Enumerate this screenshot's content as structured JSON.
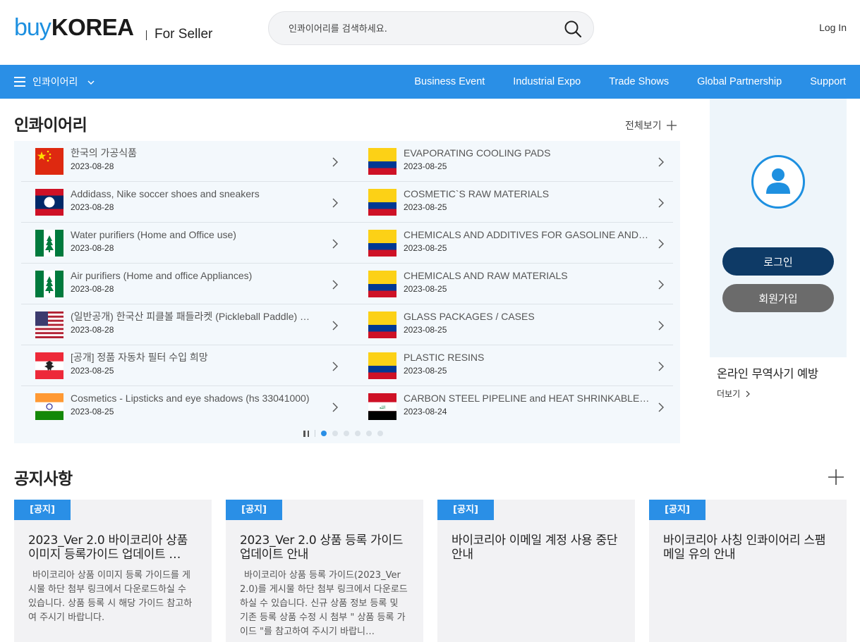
{
  "header": {
    "logo_buy": "buy",
    "logo_korea": "KOREA",
    "logo_sub": "For Seller",
    "search_placeholder": "인콰이어리를 검색하세요.",
    "login": "Log In"
  },
  "nav": {
    "menu_label": "인콰이어리",
    "links": [
      "Business Event",
      "Industrial Expo",
      "Trade Shows",
      "Global Partnership",
      "Support"
    ]
  },
  "inquiries": {
    "title": "인콰이어리",
    "view_all": "전체보기",
    "left": [
      {
        "name": "한국의 가공식품",
        "date": "2023-08-28",
        "flag": "china-flag"
      },
      {
        "name": "Addidass, Nike soccer shoes and sneakers",
        "date": "2023-08-28",
        "flag": "laos-flag"
      },
      {
        "name": "Water purifiers (Home and Office use)",
        "date": "2023-08-28",
        "flag": "norfolk-island-flag"
      },
      {
        "name": "Air purifiers (Home and office Appliances)",
        "date": "2023-08-28",
        "flag": "norfolk-island-flag"
      },
      {
        "name": "(일반공개) 한국산 피클볼 패들라켓 (Pickleball Paddle) 제…",
        "date": "2023-08-28",
        "flag": "usa-flag"
      },
      {
        "name": "[공개] 정품 자동차 필터 수입 희망",
        "date": "2023-08-25",
        "flag": "austria-flag"
      },
      {
        "name": "Cosmetics - Lipsticks and eye shadows (hs 33041000)",
        "date": "2023-08-25",
        "flag": "india-flag"
      }
    ],
    "right": [
      {
        "name": "EVAPORATING COOLING PADS",
        "date": "2023-08-25",
        "flag": "colombia-flag"
      },
      {
        "name": "COSMETIC`S RAW MATERIALS",
        "date": "2023-08-25",
        "flag": "colombia-flag"
      },
      {
        "name": "CHEMICALS AND ADDITIVES FOR GASOLINE AND HY…",
        "date": "2023-08-25",
        "flag": "colombia-flag"
      },
      {
        "name": "CHEMICALS AND RAW MATERIALS",
        "date": "2023-08-25",
        "flag": "colombia-flag"
      },
      {
        "name": "GLASS PACKAGES / CASES",
        "date": "2023-08-25",
        "flag": "colombia-flag"
      },
      {
        "name": "PLASTIC RESINS",
        "date": "2023-08-25",
        "flag": "colombia-flag"
      },
      {
        "name": "CARBON STEEL PIPELINE and HEAT SHRINKABLE SLE…",
        "date": "2023-08-24",
        "flag": "iraq-flag"
      }
    ],
    "pager": {
      "total_pages": 6,
      "active_page": 1
    }
  },
  "side": {
    "login_button": "로그인",
    "join_button": "회원가입",
    "fraud_title": "온라인 무역사기 예방",
    "fraud_more": "더보기"
  },
  "notices": {
    "title": "공지사항",
    "items": [
      {
        "tag": "[공지]",
        "title": "2023_Ver 2.0 바이코리아 상품 이미지 등록가이드 업데이트 …",
        "body": "바이코리아 상품 이미지 등록 가이드를 게시물 하단 첨부 링크에서 다운로드하실 수 있습니다. 상품 등록 시 해당 가이드 참고하여 주시기 바랍니다."
      },
      {
        "tag": "[공지]",
        "title": "2023_Ver 2.0 상품 등록 가이드 업데이트 안내",
        "body": "바이코리아 상품 등록 가이드(2023_Ver 2.0)를 게시물 하단 첨부 링크에서 다운로드하실 수 있습니다.   신규 상품 정보 등록 및 기존 등록 상품 수정 시 첨부 \" 상품 등록 가이드 \"를 참고하여 주시기 바랍니…"
      },
      {
        "tag": "[공지]",
        "title": "바이코리아 이메일 계정 사용 중단 안내",
        "body": ""
      },
      {
        "tag": "[공지]",
        "title": "바이코리아 사칭 인콰이어리 스팸 메일 유의 안내",
        "body": ""
      }
    ]
  },
  "colors": {
    "primary_blue": "#2a8fe6",
    "navy": "#0e3a66",
    "gray_button": "#6b6b6b"
  }
}
